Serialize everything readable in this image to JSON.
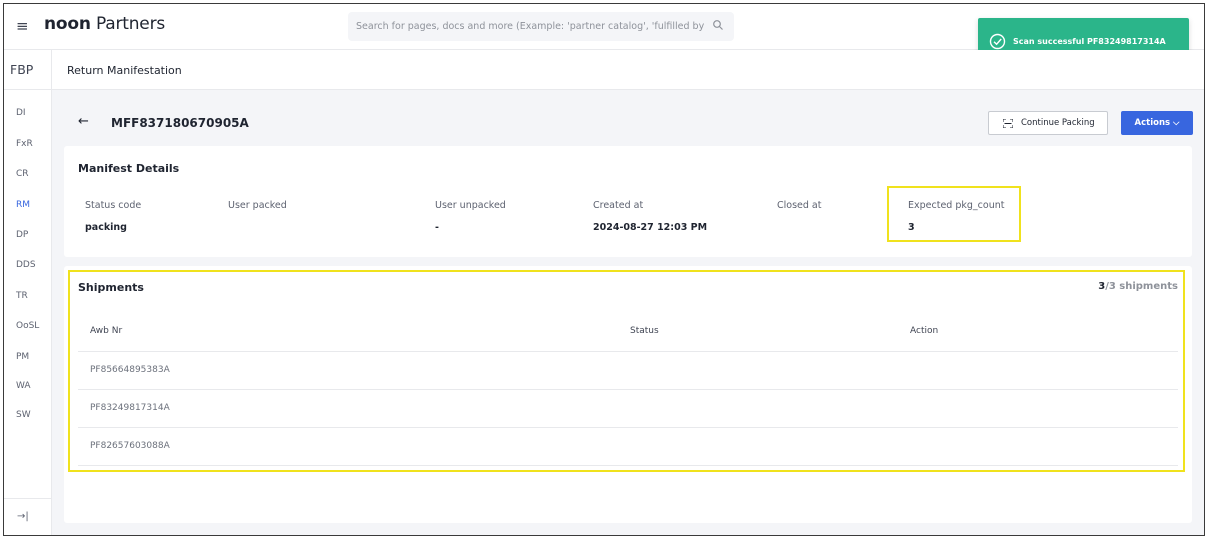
{
  "header": {
    "brand_bold": "noon",
    "brand_light": " Partners",
    "search_placeholder": "Search for pages, docs and more (Example: 'partner catalog', 'fulfilled by p"
  },
  "toast": {
    "message": "Scan successful PF83249817314A"
  },
  "sidebar": {
    "section": "FBP",
    "items": [
      {
        "label": "DI"
      },
      {
        "label": "FxR"
      },
      {
        "label": "CR"
      },
      {
        "label": "RM",
        "active": true
      },
      {
        "label": "DP"
      },
      {
        "label": "DDS"
      },
      {
        "label": "TR"
      },
      {
        "label": "OoSL"
      },
      {
        "label": "PM"
      },
      {
        "label": "WA"
      },
      {
        "label": "SW"
      }
    ],
    "expand_label": "→|"
  },
  "page": {
    "title": "Return Manifestation"
  },
  "manifest": {
    "id": "MFF837180670905A",
    "continue_packing_label": "Continue Packing",
    "actions_label": "Actions ⌵"
  },
  "details": {
    "title": "Manifest Details",
    "fields": [
      {
        "label": "Status code",
        "value": "packing"
      },
      {
        "label": "User packed",
        "value": ""
      },
      {
        "label": "User unpacked",
        "value": "-"
      },
      {
        "label": "Created at",
        "value": "2024-08-27 12:03 PM"
      },
      {
        "label": "Closed at",
        "value": ""
      },
      {
        "label": "Expected pkg_count",
        "value": "3"
      }
    ]
  },
  "shipments": {
    "title": "Shipments",
    "count": "3",
    "total": "/3 shipments",
    "columns": [
      "Awb Nr",
      "Status",
      "Action"
    ],
    "rows": [
      {
        "awb": "PF85664895383A",
        "status": "",
        "action": ""
      },
      {
        "awb": "PF83249817314A",
        "status": "",
        "action": ""
      },
      {
        "awb": "PF82657603088A",
        "status": "",
        "action": ""
      }
    ]
  },
  "colors": {
    "accent": "#3866df",
    "toast": "#2bb58a",
    "highlight": "#f0e21d"
  }
}
